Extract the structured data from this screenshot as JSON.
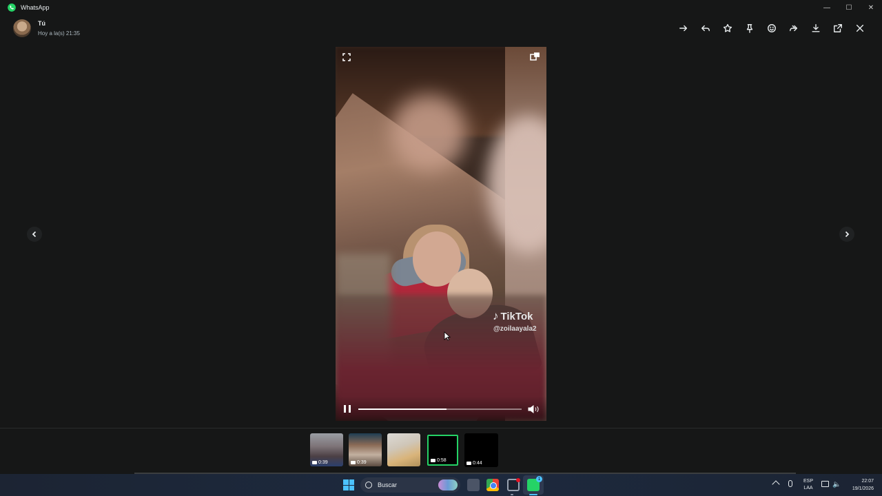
{
  "window": {
    "app_title": "WhatsApp",
    "controls": [
      "minimize",
      "maximize",
      "close"
    ]
  },
  "header": {
    "sender_name": "Tú",
    "timestamp": "Hoy a la(s) 21:35",
    "actions": [
      {
        "name": "go-to-message",
        "icon": "arrow-right-icon"
      },
      {
        "name": "reply",
        "icon": "reply-icon"
      },
      {
        "name": "star",
        "icon": "star-icon"
      },
      {
        "name": "pin",
        "icon": "pin-icon"
      },
      {
        "name": "react",
        "icon": "emoji-icon"
      },
      {
        "name": "forward",
        "icon": "forward-icon"
      },
      {
        "name": "download",
        "icon": "download-icon"
      },
      {
        "name": "open-external",
        "icon": "external-link-icon"
      },
      {
        "name": "close",
        "icon": "close-icon"
      }
    ]
  },
  "video": {
    "watermark_brand": "TikTok",
    "watermark_handle": "@zoilaayala2",
    "progress": 0.54,
    "state": "playing"
  },
  "thumbnails": [
    {
      "duration": "0:39",
      "selected": false
    },
    {
      "duration": "0:39",
      "selected": false
    },
    {
      "duration": "",
      "selected": false
    },
    {
      "duration": "0:58",
      "selected": true
    },
    {
      "duration": "0:44",
      "selected": false
    }
  ],
  "taskbar": {
    "search_label": "Buscar",
    "language_line1": "ESP",
    "language_line2": "LAA",
    "time": "22:07",
    "date": "19/1/2026",
    "whatsapp_badge": "1"
  },
  "colors": {
    "accent": "#25d366",
    "background": "#161717"
  }
}
